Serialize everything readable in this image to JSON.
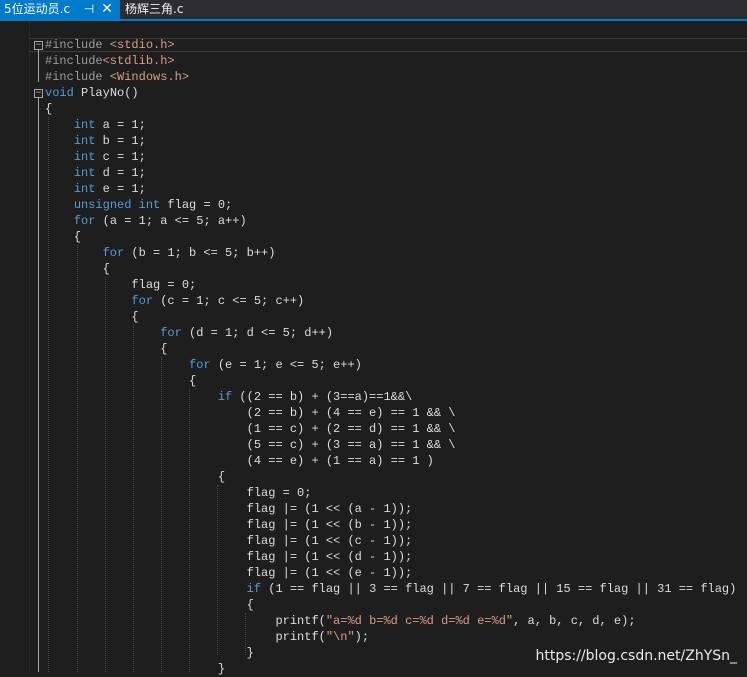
{
  "tabs": [
    {
      "label": "5位运动员.c",
      "active": true,
      "pin_glyph": "⊣",
      "close_glyph": "✕"
    },
    {
      "label": "杨辉三角.c",
      "active": false
    }
  ],
  "watermark": "https://blog.csdn.net/ZhYSn_",
  "colors": {
    "keyword": "#569cd6",
    "string": "#d69d85",
    "text": "#dcdcdc",
    "tab_active": "#007acc",
    "background": "#1e1e1e"
  },
  "code_lines": [
    [
      {
        "t": "#include ",
        "c": "pp"
      },
      {
        "t": "<stdio.h>",
        "c": "str"
      }
    ],
    [
      {
        "t": "#include",
        "c": "pp"
      },
      {
        "t": "<stdlib.h>",
        "c": "str"
      }
    ],
    [
      {
        "t": "#include ",
        "c": "pp"
      },
      {
        "t": "<Windows.h>",
        "c": "str"
      }
    ],
    [
      {
        "t": "void",
        "c": "kw"
      },
      {
        "t": " PlayNo()",
        "c": ""
      }
    ],
    [
      {
        "t": "{",
        "c": ""
      }
    ],
    [
      {
        "t": "    ",
        "c": ""
      },
      {
        "t": "int",
        "c": "kw"
      },
      {
        "t": " a = 1;",
        "c": ""
      }
    ],
    [
      {
        "t": "    ",
        "c": ""
      },
      {
        "t": "int",
        "c": "kw"
      },
      {
        "t": " b = 1;",
        "c": ""
      }
    ],
    [
      {
        "t": "    ",
        "c": ""
      },
      {
        "t": "int",
        "c": "kw"
      },
      {
        "t": " c = 1;",
        "c": ""
      }
    ],
    [
      {
        "t": "    ",
        "c": ""
      },
      {
        "t": "int",
        "c": "kw"
      },
      {
        "t": " d = 1;",
        "c": ""
      }
    ],
    [
      {
        "t": "    ",
        "c": ""
      },
      {
        "t": "int",
        "c": "kw"
      },
      {
        "t": " e = 1;",
        "c": ""
      }
    ],
    [
      {
        "t": "    ",
        "c": ""
      },
      {
        "t": "unsigned",
        "c": "kw"
      },
      {
        "t": " ",
        "c": ""
      },
      {
        "t": "int",
        "c": "kw"
      },
      {
        "t": " flag = 0;",
        "c": ""
      }
    ],
    [
      {
        "t": "    ",
        "c": ""
      },
      {
        "t": "for",
        "c": "kw"
      },
      {
        "t": " (a = 1; a <= 5; a++)",
        "c": ""
      }
    ],
    [
      {
        "t": "    {",
        "c": ""
      }
    ],
    [
      {
        "t": "        ",
        "c": ""
      },
      {
        "t": "for",
        "c": "kw"
      },
      {
        "t": " (b = 1; b <= 5; b++)",
        "c": ""
      }
    ],
    [
      {
        "t": "        {",
        "c": ""
      }
    ],
    [
      {
        "t": "            flag = 0;",
        "c": ""
      }
    ],
    [
      {
        "t": "            ",
        "c": ""
      },
      {
        "t": "for",
        "c": "kw"
      },
      {
        "t": " (c = 1; c <= 5; c++)",
        "c": ""
      }
    ],
    [
      {
        "t": "            {",
        "c": ""
      }
    ],
    [
      {
        "t": "                ",
        "c": ""
      },
      {
        "t": "for",
        "c": "kw"
      },
      {
        "t": " (d = 1; d <= 5; d++)",
        "c": ""
      }
    ],
    [
      {
        "t": "                {",
        "c": ""
      }
    ],
    [
      {
        "t": "                    ",
        "c": ""
      },
      {
        "t": "for",
        "c": "kw"
      },
      {
        "t": " (e = 1; e <= 5; e++)",
        "c": ""
      }
    ],
    [
      {
        "t": "                    {",
        "c": ""
      }
    ],
    [
      {
        "t": "                        ",
        "c": ""
      },
      {
        "t": "if",
        "c": "kw"
      },
      {
        "t": " ((2 == b) + (3==a)==1&&\\",
        "c": ""
      }
    ],
    [
      {
        "t": "                            (2 == b) + (4 == e) == 1 && \\",
        "c": ""
      }
    ],
    [
      {
        "t": "                            (1 == c) + (2 == d) == 1 && \\",
        "c": ""
      }
    ],
    [
      {
        "t": "                            (5 == c) + (3 == a) == 1 && \\",
        "c": ""
      }
    ],
    [
      {
        "t": "                            (4 == e) + (1 == a) == 1 )",
        "c": ""
      }
    ],
    [
      {
        "t": "                        {",
        "c": ""
      }
    ],
    [
      {
        "t": "                            flag = 0;",
        "c": ""
      }
    ],
    [
      {
        "t": "                            flag |= (1 << (a - 1));",
        "c": ""
      }
    ],
    [
      {
        "t": "                            flag |= (1 << (b - 1));",
        "c": ""
      }
    ],
    [
      {
        "t": "                            flag |= (1 << (c - 1));",
        "c": ""
      }
    ],
    [
      {
        "t": "                            flag |= (1 << (d - 1));",
        "c": ""
      }
    ],
    [
      {
        "t": "                            flag |= (1 << (e - 1));",
        "c": ""
      }
    ],
    [
      {
        "t": "                            ",
        "c": ""
      },
      {
        "t": "if",
        "c": "kw"
      },
      {
        "t": " (1 == flag || 3 == flag || 7 == flag || 15 == flag || 31 == flag)",
        "c": ""
      }
    ],
    [
      {
        "t": "                            {",
        "c": ""
      }
    ],
    [
      {
        "t": "                                printf(",
        "c": ""
      },
      {
        "t": "\"a=%d b=%d c=%d d=%d e=%d\"",
        "c": "str"
      },
      {
        "t": ", a, b, c, d, e);",
        "c": ""
      }
    ],
    [
      {
        "t": "                                printf(",
        "c": ""
      },
      {
        "t": "\"\\n\"",
        "c": "str"
      },
      {
        "t": ");",
        "c": ""
      }
    ],
    [
      {
        "t": "                            }",
        "c": ""
      }
    ],
    [
      {
        "t": "                        }",
        "c": ""
      }
    ]
  ]
}
